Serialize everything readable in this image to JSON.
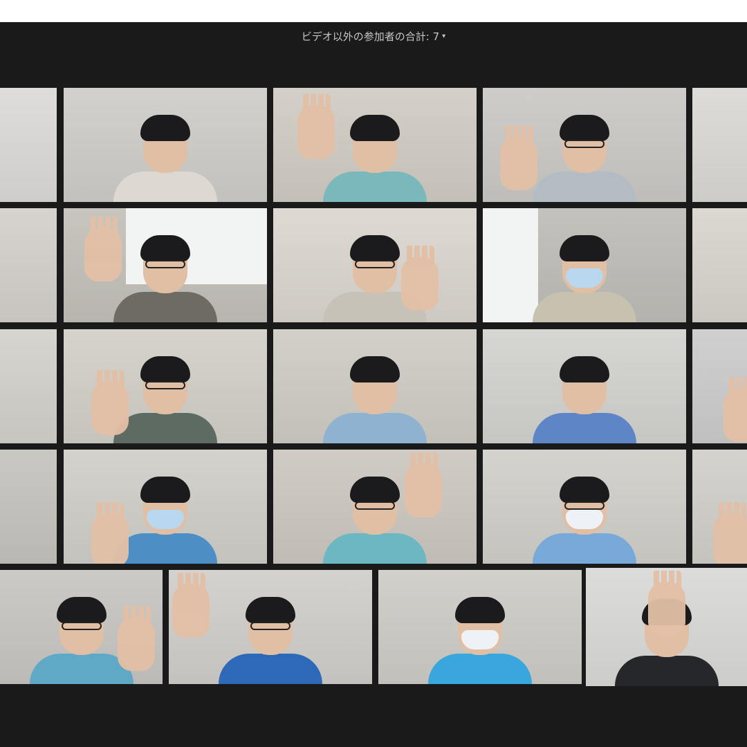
{
  "header": {
    "participants_label": "ビデオ以外の参加者の合計: 7",
    "dropdown_icon": "caret-down-icon"
  },
  "colors": {
    "window_bg": "#1a1a1a",
    "header_text": "#c8c8c8",
    "active_speaker_border": "#c8e43c",
    "light_blue_uniform": "#8fc0cc",
    "blue_shirt": "#5e86c6",
    "teal_polo": "#39a6dd"
  },
  "grid": {
    "row_count": 5,
    "visible_tiles": 23,
    "active_speaker_tile": "row5-col4"
  }
}
